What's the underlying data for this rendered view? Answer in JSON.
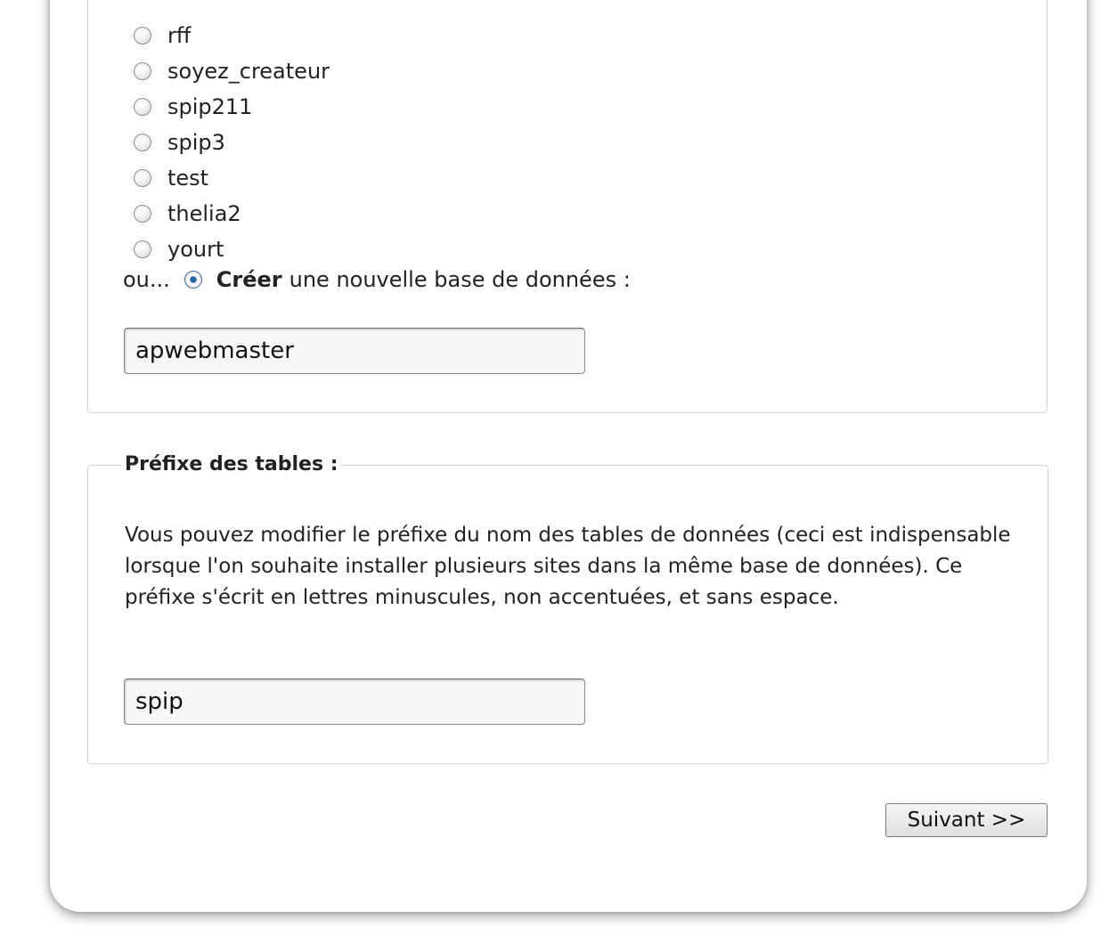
{
  "databases": {
    "options": [
      {
        "label": "rff",
        "selected": false
      },
      {
        "label": "soyez_createur",
        "selected": false
      },
      {
        "label": "spip211",
        "selected": false
      },
      {
        "label": "spip3",
        "selected": false
      },
      {
        "label": "test",
        "selected": false
      },
      {
        "label": "thelia2",
        "selected": false
      },
      {
        "label": "yourt",
        "selected": false
      }
    ],
    "create": {
      "prefix": "ou...",
      "strong_label": "Créer",
      "label_rest": "une nouvelle base de données :",
      "selected": true
    },
    "new_db_name": "apwebmaster"
  },
  "prefix_section": {
    "legend": "Préfixe des tables :",
    "description": "Vous pouvez modifier le préfixe du nom des tables de données (ceci est indispensable lorsque l'on souhaite installer plusieurs sites dans la même base de données). Ce préfixe s'écrit en lettres minuscules, non accentuées, et sans espace.",
    "value": "spip"
  },
  "next_button": {
    "label": "Suivant >>"
  }
}
